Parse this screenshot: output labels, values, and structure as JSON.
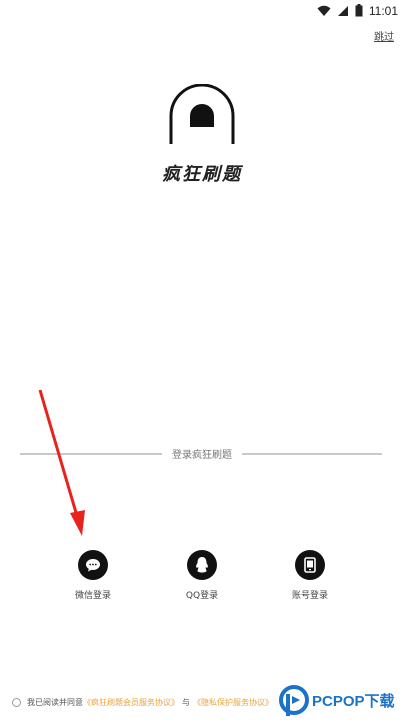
{
  "status_bar": {
    "time": "11:01",
    "icons": [
      "wifi-icon",
      "signal-icon",
      "battery-icon"
    ]
  },
  "skip": {
    "label": "跳过"
  },
  "app": {
    "name": "疯狂刷题"
  },
  "login": {
    "divider_label": "登录疯狂刷题",
    "options": [
      {
        "label": "微信登录",
        "icon": "wechat-icon"
      },
      {
        "label": "QQ登录",
        "icon": "qq-icon"
      },
      {
        "label": "账号登录",
        "icon": "phone-icon"
      }
    ]
  },
  "agreement": {
    "prefix": "我已阅读并同意",
    "link1": "《疯狂刷题会员服务协议》",
    "conj": "与",
    "link2": "《隐私保护服务协议》"
  },
  "watermark": {
    "text": "PCPOP下载"
  },
  "colors": {
    "accent": "#e8a33a",
    "arrow": "#e8231c",
    "watermark": "#1a73c8",
    "icon_bg": "#111111"
  }
}
